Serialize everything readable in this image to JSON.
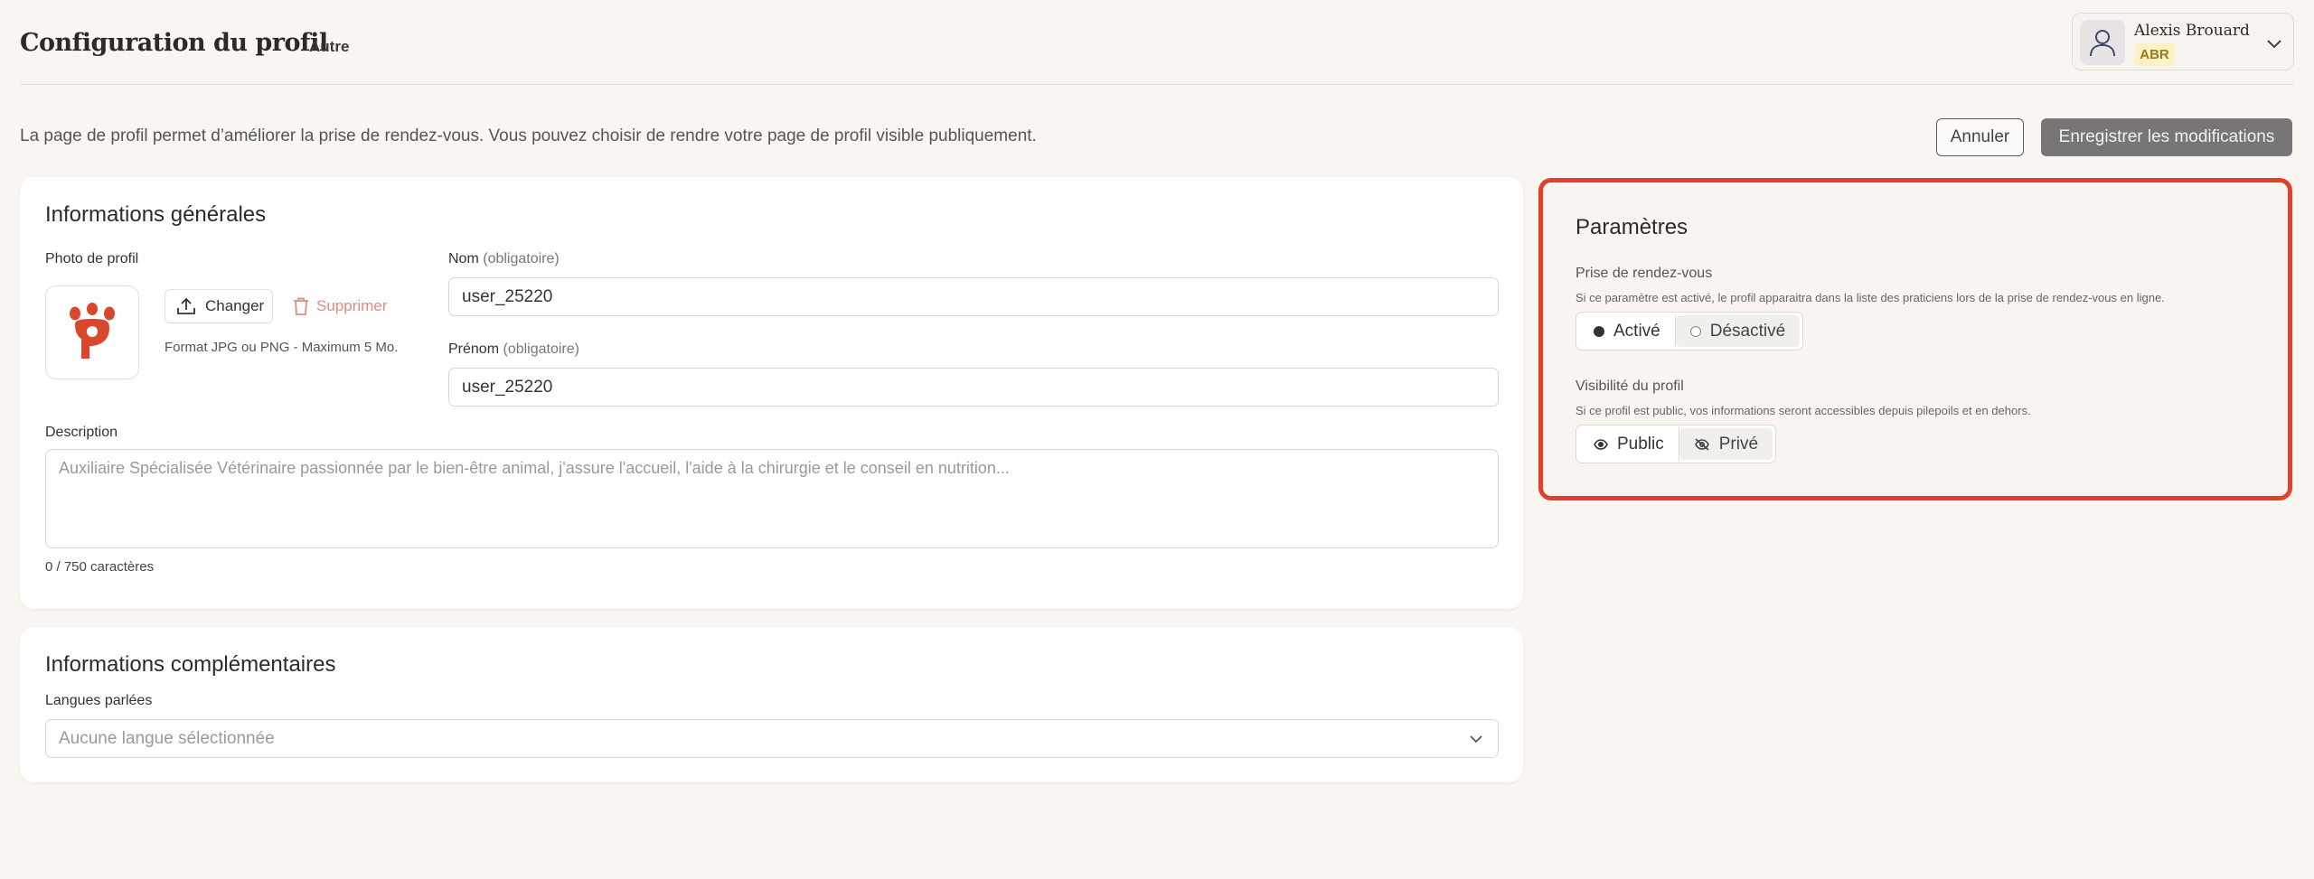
{
  "header": {
    "title": "Configuration du profil",
    "subtitle": "Autre",
    "user": {
      "name": "Alexis Brouard",
      "initials": "ABR"
    }
  },
  "intro": {
    "text": "La page de profil permet d’améliorer la prise de rendez-vous. Vous pouvez choisir de rendre votre page de profil visible publiquement.",
    "cancel_label": "Annuler",
    "save_label": "Enregistrer les modifications"
  },
  "general": {
    "title": "Informations générales",
    "photo_label": "Photo de profil",
    "change_label": "Changer",
    "delete_label": "Supprimer",
    "format_hint": "Format JPG ou PNG - Maximum 5 Mo.",
    "nom_label": "Nom",
    "nom_required": "(obligatoire)",
    "nom_value": "user_25220",
    "prenom_label": "Prénom",
    "prenom_required": "(obligatoire)",
    "prenom_value": "user_25220",
    "description_label": "Description",
    "description_placeholder": "Auxiliaire Spécialisée Vétérinaire passionnée par le bien-être animal, j'assure l'accueil, l'aide à la chirurgie et le conseil en nutrition...",
    "char_count": "0 / 750 caractères"
  },
  "extra": {
    "title": "Informations complémentaires",
    "languages_label": "Langues parlées",
    "languages_placeholder": "Aucune langue sélectionnée"
  },
  "settings": {
    "title": "Paramètres",
    "booking": {
      "label": "Prise de rendez-vous",
      "description": "Si ce paramètre est activé, le profil apparaitra dans la liste des praticiens lors de la prise de rendez-vous en ligne.",
      "option_on": "Activé",
      "option_off": "Désactivé",
      "selected": "Activé"
    },
    "visibility": {
      "label": "Visibilité du profil",
      "description": "Si ce profil est public, vos informations seront accessibles depuis pilepoils et en dehors.",
      "option_public": "Public",
      "option_private": "Privé",
      "selected": "Public"
    }
  },
  "colors": {
    "accent_border": "#e2402a",
    "brand_paw": "#d9482e",
    "save_button": "#777575",
    "badge_bg": "#fdf1c5",
    "badge_text": "#9a7a1e"
  },
  "icons": {
    "avatar": "user-icon",
    "chevron": "chevron-down-icon",
    "upload": "upload-icon",
    "trash": "trash-icon",
    "eye": "eye-icon",
    "eye_off": "eye-off-icon",
    "logo": "paw-logo"
  }
}
